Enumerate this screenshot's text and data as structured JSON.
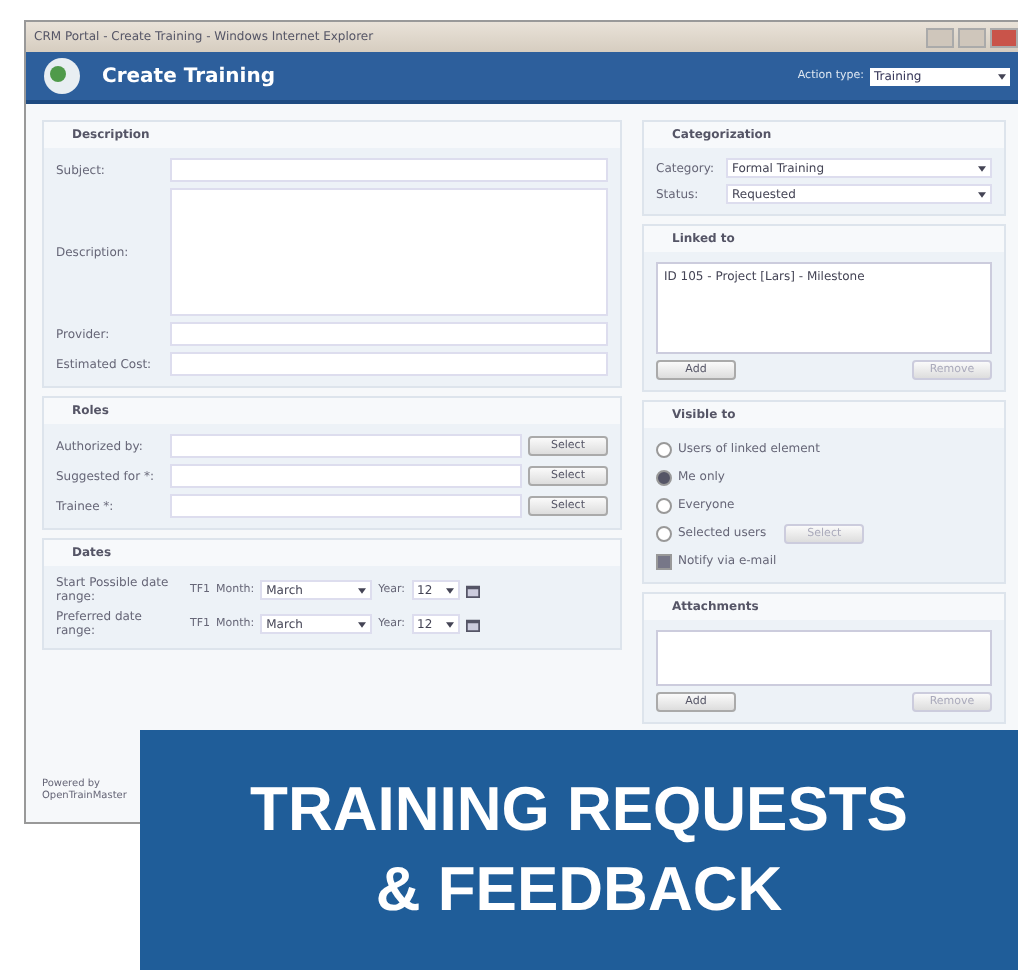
{
  "window": {
    "title": "CRM Portal - Create Training - Windows Internet Explorer"
  },
  "header": {
    "title": "Create Training",
    "action_label": "Action type:",
    "action_value": "Training"
  },
  "description": {
    "title": "Description",
    "fields": [
      {
        "label": "Subject:",
        "kind": "input"
      },
      {
        "label": "Description:",
        "kind": "textarea"
      },
      {
        "label": "Provider:",
        "kind": "input"
      },
      {
        "label": "Estimated Cost:",
        "kind": "input"
      }
    ]
  },
  "roles": {
    "title": "Roles",
    "rows": [
      {
        "label": "Authorized by:",
        "button": "Select"
      },
      {
        "label": "Suggested for *:",
        "button": "Select"
      },
      {
        "label": "Trainee *:",
        "button": "Select"
      }
    ]
  },
  "dates": {
    "title": "Dates",
    "rows": [
      {
        "label": "Start Possible date range:",
        "code": "TF1",
        "month_label": "Month:",
        "month": "March",
        "year_label": "Year:",
        "year": "12"
      },
      {
        "label": "Preferred date range:",
        "code": "TF1",
        "month_label": "Month:",
        "month": "March",
        "year_label": "Year:",
        "year": "12"
      }
    ]
  },
  "footer": {
    "lines": [
      "Powered by",
      "OpenTrainMaster"
    ]
  },
  "categorization": {
    "title": "Categorization",
    "fields": [
      {
        "label": "Category:",
        "value": "Formal Training"
      },
      {
        "label": "Status:",
        "value": "Requested"
      }
    ]
  },
  "linked": {
    "title": "Linked to",
    "items": [
      "ID 105 - Project [Lars] - Milestone"
    ],
    "add": "Add",
    "remove": "Remove"
  },
  "visible": {
    "title": "Visible to",
    "options": [
      {
        "kind": "radio",
        "label": "Users of linked element",
        "selected": false
      },
      {
        "kind": "radio",
        "label": "Me only",
        "selected": true
      },
      {
        "kind": "radio",
        "label": "Everyone",
        "selected": false
      },
      {
        "kind": "radio",
        "label": "Selected users",
        "selected": false,
        "button": "Select"
      },
      {
        "kind": "checkbox",
        "label": "Notify via e-mail",
        "checked": true
      }
    ]
  },
  "attachments": {
    "title": "Attachments",
    "add": "Add",
    "remove": "Remove"
  },
  "banner": {
    "lines": [
      "TRAINING REQUESTS",
      "& FEEDBACK"
    ]
  }
}
